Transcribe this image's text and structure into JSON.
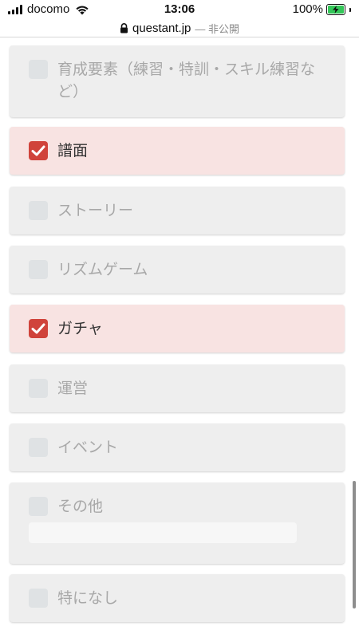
{
  "status_bar": {
    "carrier": "docomo",
    "time": "13:06",
    "battery": "100%",
    "battery_level": 1.0,
    "signal_icon": "signal-bars-icon",
    "wifi_icon": "wifi-icon",
    "battery_icon": "battery-charging-icon"
  },
  "url_bar": {
    "domain": "questant.jp",
    "status": "— 非公開",
    "lock_icon": "lock-icon"
  },
  "options": [
    {
      "label": "育成要素（練習・特訓・スキル練習など）",
      "checked": false
    },
    {
      "label": "譜面",
      "checked": true
    },
    {
      "label": "ストーリー",
      "checked": false
    },
    {
      "label": "リズムゲーム",
      "checked": false
    },
    {
      "label": "ガチャ",
      "checked": true
    },
    {
      "label": "運営",
      "checked": false
    },
    {
      "label": "イベント",
      "checked": false
    },
    {
      "label": "その他",
      "checked": false,
      "other_input_value": ""
    },
    {
      "label": "特になし",
      "checked": false
    }
  ],
  "colors": {
    "checked_bg": "#f8e3e2",
    "unchecked_bg": "#eeeeee",
    "checkbox_checked": "#d0433b",
    "checkbox_unchecked": "#dfe2e4",
    "battery_charging": "#34c759"
  }
}
